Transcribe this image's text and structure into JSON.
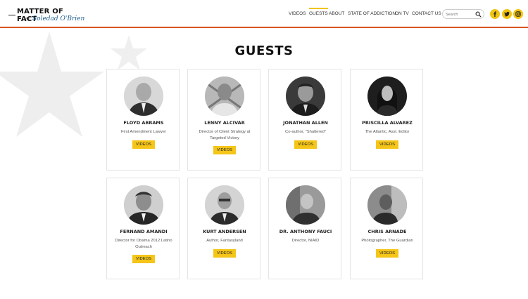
{
  "brand": {
    "title": "MATTER OF FACT",
    "with": "with",
    "subtitle": "Soledad O'Brien"
  },
  "nav": {
    "items": [
      {
        "label": "VIDEOS",
        "active": false
      },
      {
        "label": "GUESTS",
        "active": true
      },
      {
        "label": "ABOUT",
        "active": false
      },
      {
        "label": "STATE OF ADDICTION",
        "active": false
      },
      {
        "label": "ON TV",
        "active": false
      },
      {
        "label": "CONTACT US",
        "active": false
      }
    ]
  },
  "search": {
    "placeholder": "Search",
    "icon": "search-icon"
  },
  "social": [
    {
      "name": "facebook-icon",
      "glyph": "f"
    },
    {
      "name": "twitter-icon",
      "glyph": "t"
    },
    {
      "name": "instagram-icon",
      "glyph": "ig"
    }
  ],
  "colors": {
    "accent": "#f1c40f",
    "header_border": "#d9541e",
    "brand_blue": "#1f5f8f"
  },
  "page": {
    "title": "GUESTS"
  },
  "guests": [
    {
      "name": "FLOYD ABRAMS",
      "role": "First Amendment Lawyer",
      "button": "VIDEOS"
    },
    {
      "name": "LENNY ALCIVAR",
      "role": "Director of Client Strategy at Targeted Victory",
      "button": "VIDEOS"
    },
    {
      "name": "JONATHAN ALLEN",
      "role": "Co-author, \"Shattered\"",
      "button": "VIDEOS"
    },
    {
      "name": "PRISCILLA ALVAREZ",
      "role": "The Atlantic, Asst. Editor",
      "button": "VIDEOS"
    },
    {
      "name": "FERNAND AMANDI",
      "role": "Director for Obama 2012 Latino Outreach",
      "button": "VIDEOS"
    },
    {
      "name": "KURT ANDERSEN",
      "role": "Author, Fantasyland",
      "button": "VIDEOS"
    },
    {
      "name": "DR. ANTHONY FAUCI",
      "role": "Director, NIAID",
      "button": ""
    },
    {
      "name": "CHRIS ARNADE",
      "role": "Photographer, The Guardian",
      "button": "VIDEOS"
    }
  ]
}
